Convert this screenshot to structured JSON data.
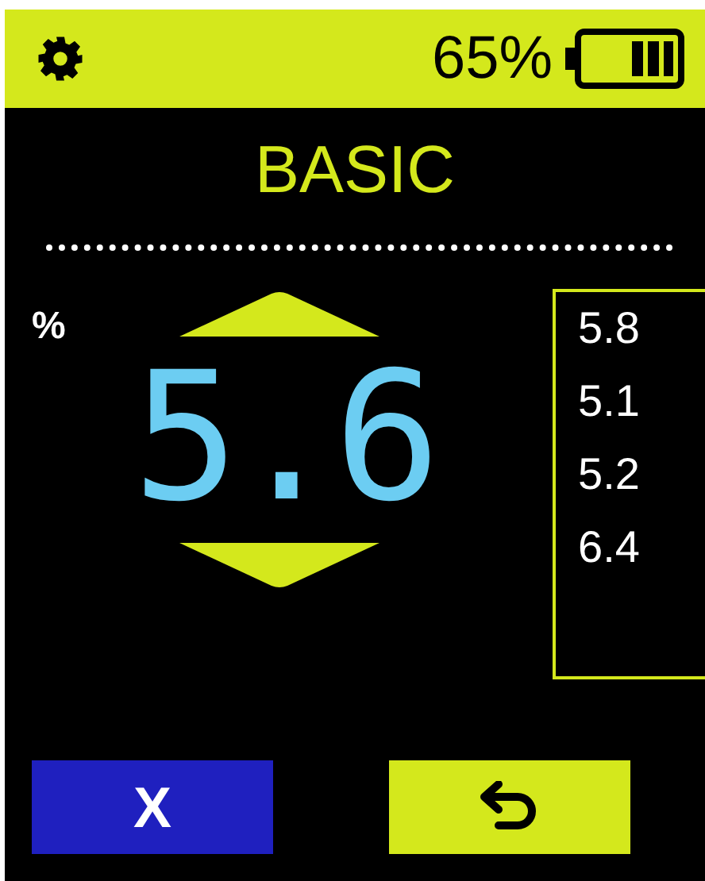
{
  "status_bar": {
    "battery": "65%"
  },
  "title": "BASIC",
  "unit": "%",
  "value": "5.6",
  "history": [
    "5.8",
    "5.1",
    "5.2",
    "6.4"
  ],
  "buttons": [
    {
      "kind": "cancel",
      "label": "X"
    },
    {
      "kind": "back"
    }
  ]
}
